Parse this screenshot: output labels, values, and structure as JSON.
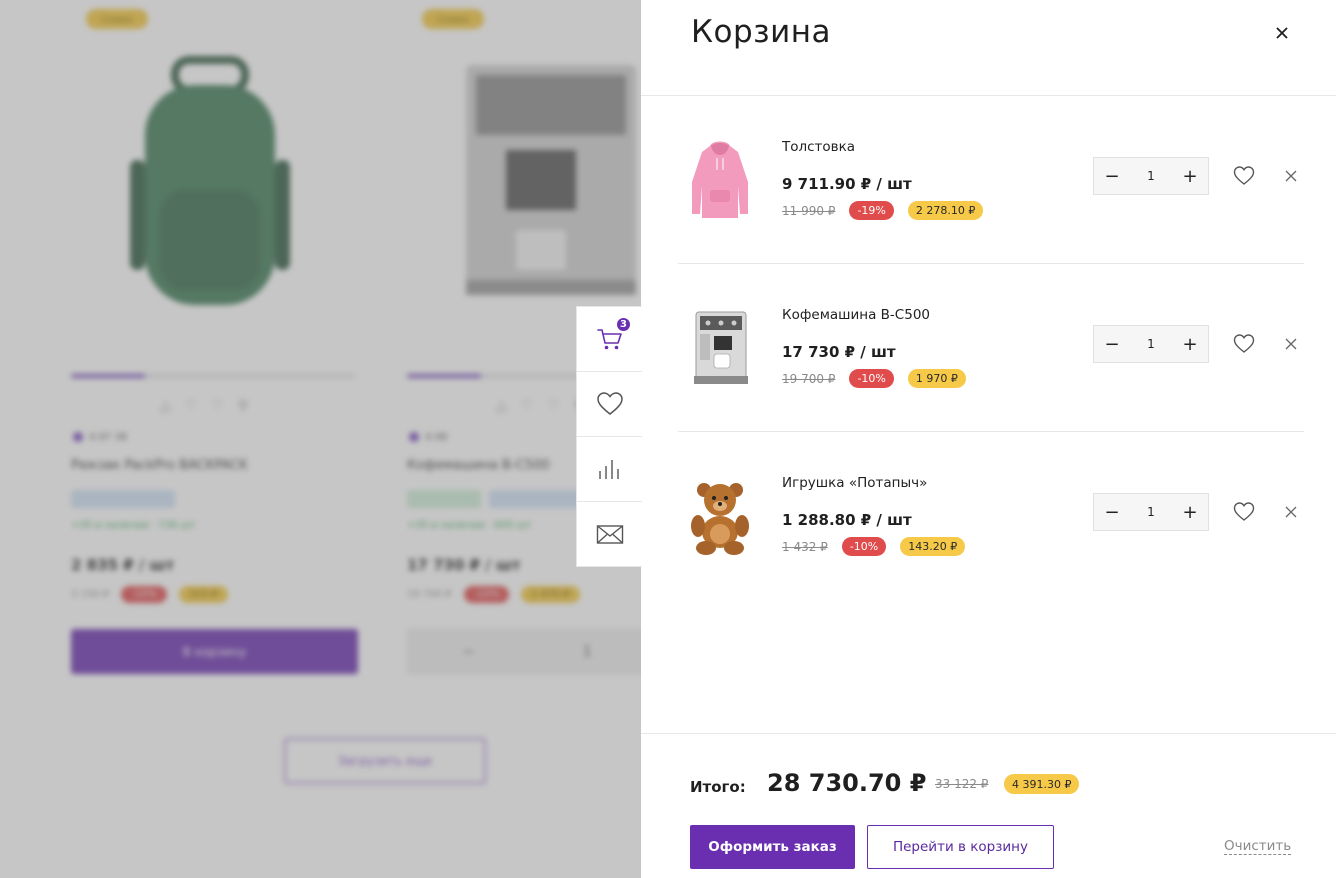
{
  "background_catalog": {
    "products": [
      {
        "name": "Рюкзак PackPro BACKPACK",
        "badge": "Скидка",
        "price": "2 835 ₽ / шт",
        "button": "В корзину"
      },
      {
        "name": "Кофемашина B-C500",
        "badge": "Скидка",
        "price": "17 730 ₽ / шт"
      }
    ],
    "load_more": "Загрузить еще"
  },
  "side_toolbar": {
    "cart_count": "3",
    "items": [
      {
        "icon": "cart-icon"
      },
      {
        "icon": "heart-icon"
      },
      {
        "icon": "compare-icon"
      },
      {
        "icon": "mail-icon"
      }
    ]
  },
  "cart": {
    "title": "Корзина",
    "items": [
      {
        "name": "Толстовка",
        "price": "9 711.90 ₽ / шт",
        "old_price": "11 990 ₽",
        "discount": "-19%",
        "saving": "2 278.10 ₽",
        "qty": "1",
        "image": "hoodie"
      },
      {
        "name": "Кофемашина B-C500",
        "price": "17 730 ₽ / шт",
        "old_price": "19 700 ₽",
        "discount": "-10%",
        "saving": "1 970 ₽",
        "qty": "1",
        "image": "coffee-machine"
      },
      {
        "name": "Игрушка «Потапыч»",
        "price": "1 288.80 ₽ / шт",
        "old_price": "1 432 ₽",
        "discount": "-10%",
        "saving": "143.20 ₽",
        "qty": "1",
        "image": "teddy-bear"
      }
    ],
    "total_label": "Итого:",
    "total_value": "28 730.70 ₽",
    "total_old": "33 122 ₽",
    "total_saving": "4 391.30 ₽",
    "order_button": "Оформить заказ",
    "go_cart_button": "Перейти в корзину",
    "clear_button": "Очистить"
  },
  "colors": {
    "accent": "#6a2fb0",
    "discount": "#e04b4b",
    "saving": "#f7c948"
  }
}
